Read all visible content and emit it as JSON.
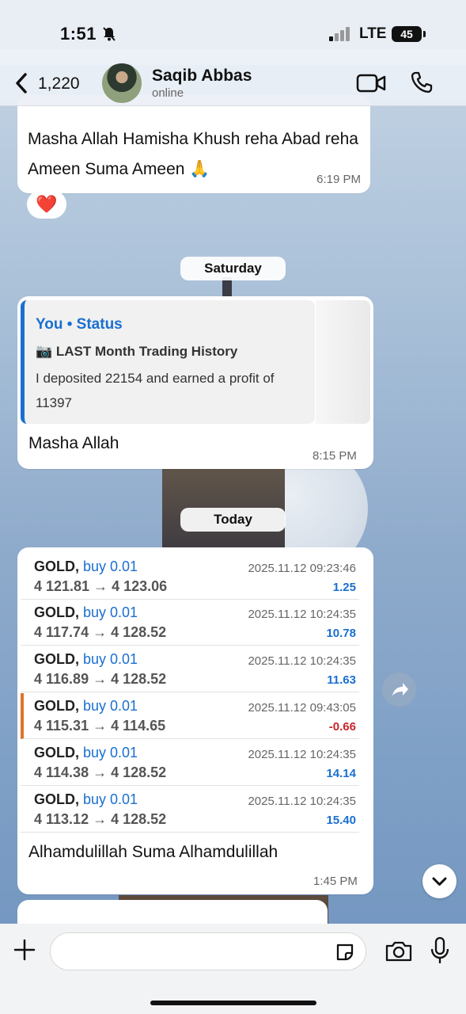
{
  "status_bar": {
    "time": "1:51",
    "network": "LTE",
    "battery": "45"
  },
  "header": {
    "back_count": "1,220",
    "contact_name": "Saqib Abbas",
    "contact_status": "online"
  },
  "messages": {
    "m1": {
      "text": "Masha Allah Hamisha Khush reha Abad reha Ameen Suma Ameen 🙏",
      "time": "6:19 PM",
      "reaction": "❤️"
    },
    "day1": "Saturday",
    "m2": {
      "quote_title": "You • Status",
      "quote_subtitle": "📷 LAST Month Trading History",
      "quote_body": "I deposited 22154 and earned a profit of 11397",
      "text": "Masha Allah",
      "time": "8:15 PM"
    },
    "day2": "Today",
    "m3": {
      "trades": [
        {
          "symbol": "GOLD,",
          "direction": "buy 0.01",
          "prices": "4 121.81 → 4 123.06",
          "datetime": "2025.11.12 09:23:46",
          "profit": "1.25"
        },
        {
          "symbol": "GOLD,",
          "direction": "buy 0.01",
          "prices": "4 117.74 → 4 128.52",
          "datetime": "2025.11.12 10:24:35",
          "profit": "10.78"
        },
        {
          "symbol": "GOLD,",
          "direction": "buy 0.01",
          "prices": "4 116.89 → 4 128.52",
          "datetime": "2025.11.12 10:24:35",
          "profit": "11.63"
        },
        {
          "symbol": "GOLD,",
          "direction": "buy 0.01",
          "prices": "4 115.31 → 4 114.65",
          "datetime": "2025.11.12 09:43:05",
          "profit": "-0.66"
        },
        {
          "symbol": "GOLD,",
          "direction": "buy 0.01",
          "prices": "4 114.38 → 4 128.52",
          "datetime": "2025.11.12 10:24:35",
          "profit": "14.14"
        },
        {
          "symbol": "GOLD,",
          "direction": "buy 0.01",
          "prices": "4 113.12 → 4 128.52",
          "datetime": "2025.11.12 10:24:35",
          "profit": "15.40"
        }
      ],
      "text": "Alhamdulillah Suma Alhamdulillah",
      "time": "1:45 PM"
    }
  },
  "input": {
    "value": ""
  },
  "colors": {
    "accent": "#1a6fd0",
    "loss": "#c8252c",
    "alert_bar": "#e0732b"
  },
  "icons": [
    "back-chevron-icon",
    "video-icon",
    "phone-icon",
    "forward-icon",
    "chevron-down-icon",
    "plus-icon",
    "sticker-icon",
    "camera-icon",
    "mic-icon",
    "mute-icon"
  ]
}
